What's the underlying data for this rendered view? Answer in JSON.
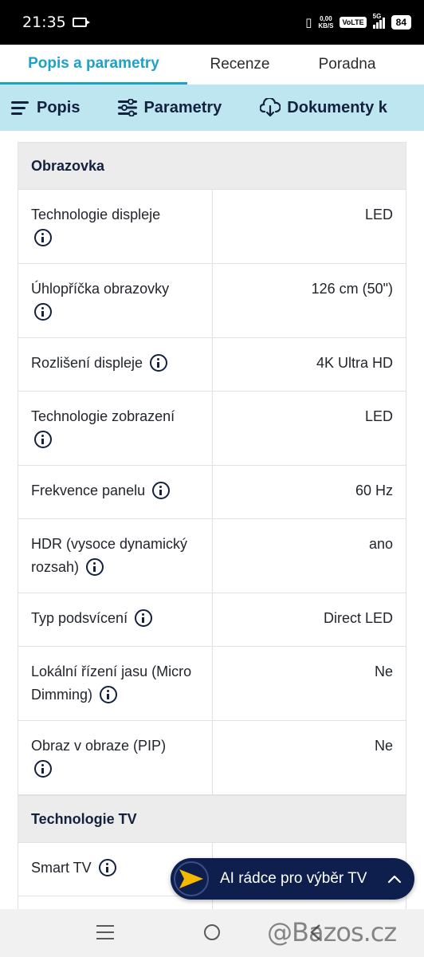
{
  "status": {
    "time": "21:35",
    "net_speed_value": "0,00",
    "net_speed_unit": "KB/S",
    "volte": "VoLTE",
    "network": "5G",
    "battery": "84"
  },
  "tabs": [
    {
      "label": "Popis a parametry",
      "active": true
    },
    {
      "label": "Recenze",
      "active": false
    },
    {
      "label": "Poradna",
      "active": false
    }
  ],
  "subnav": [
    {
      "label": "Popis",
      "icon": "lines-icon"
    },
    {
      "label": "Parametry",
      "icon": "sliders-icon"
    },
    {
      "label": "Dokumenty k",
      "icon": "cloud-download-icon"
    }
  ],
  "sections": [
    {
      "title": "Obrazovka",
      "rows": [
        {
          "label": "Technologie displeje",
          "value": "LED"
        },
        {
          "label": "Úhlopříčka obrazovky",
          "value": "126 cm (50\")"
        },
        {
          "label": "Rozlišení displeje",
          "value": "4K Ultra HD"
        },
        {
          "label": "Technologie zobrazení",
          "value": "LED"
        },
        {
          "label": "Frekvence panelu",
          "value": "60 Hz"
        },
        {
          "label": "HDR (vysoce dynamický rozsah)",
          "value": "ano"
        },
        {
          "label": "Typ podsvícení",
          "value": "Direct LED"
        },
        {
          "label": "Lokální řízení jasu (Micro Dimming)",
          "value": "Ne"
        },
        {
          "label": "Obraz v obraze (PIP)",
          "value": "Ne"
        }
      ]
    },
    {
      "title": "Technologie TV",
      "rows": [
        {
          "label": "Smart TV",
          "value": ""
        }
      ]
    }
  ],
  "ai_button": {
    "label": "AI rádce pro výběr TV"
  },
  "watermark": "@Bazos.cz",
  "colors": {
    "accent": "#1ea0c8",
    "subnav_bg": "#bde6f1",
    "navy": "#14213d",
    "ai_bg": "#0e1e4d",
    "ai_arrow": "#f5b800"
  }
}
